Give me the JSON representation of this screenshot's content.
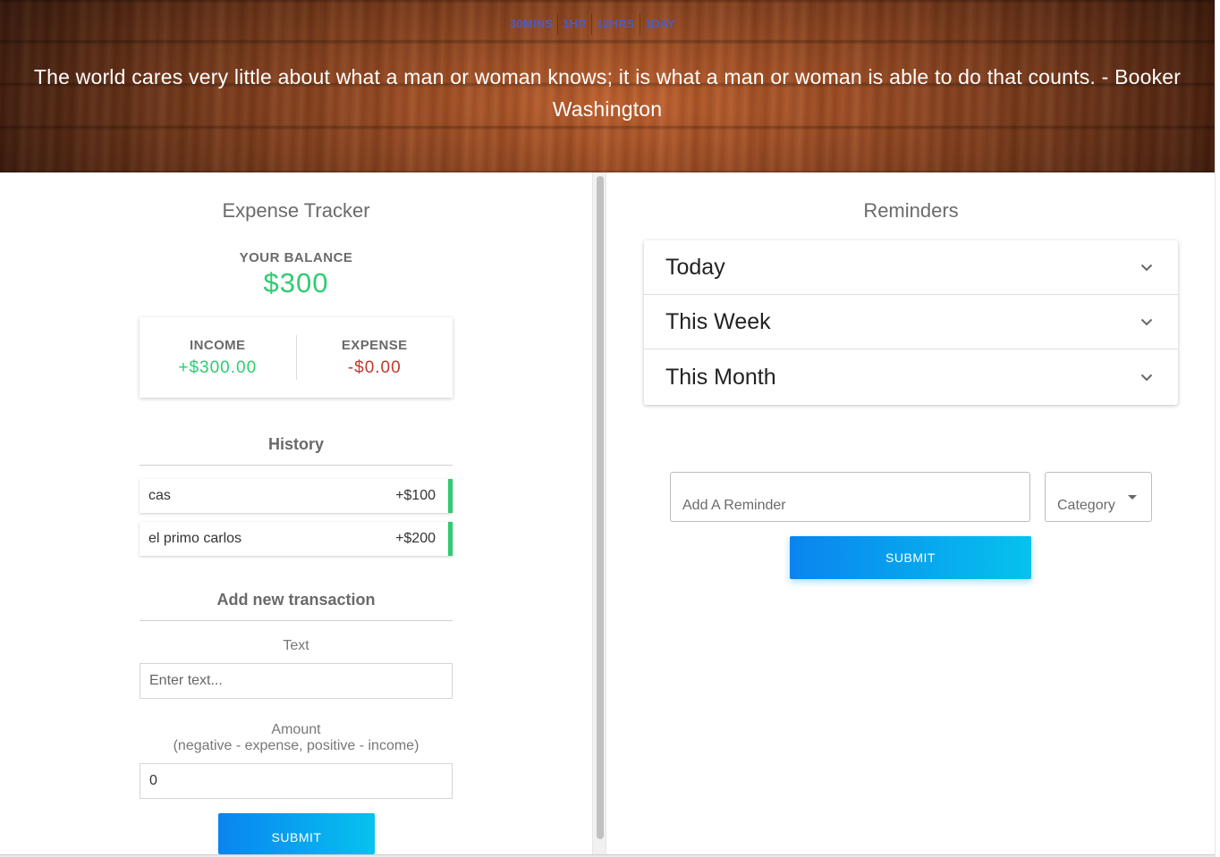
{
  "header": {
    "timer_tabs": [
      "30MINS",
      "1HR",
      "12HRS",
      "1DAY"
    ],
    "quote": "The world cares very little about what a man or woman knows; it is what a man or woman is able to do that counts. - Booker Washington"
  },
  "expense_tracker": {
    "title": "Expense Tracker",
    "balance_label": "YOUR BALANCE",
    "balance_value": "$300",
    "income_label": "INCOME",
    "income_value": "+$300.00",
    "expense_label": "EXPENSE",
    "expense_value": "-$0.00",
    "history_title": "History",
    "history": [
      {
        "text": "cas",
        "amount": "+$100"
      },
      {
        "text": "el primo carlos",
        "amount": "+$200"
      }
    ],
    "add_title": "Add new transaction",
    "text_label": "Text",
    "text_placeholder": "Enter text...",
    "amount_label_line1": "Amount",
    "amount_label_line2": "(negative - expense, positive - income)",
    "amount_value": "0",
    "submit_label": "SUBMIT"
  },
  "reminders": {
    "title": "Reminders",
    "sections": [
      "Today",
      "This Week",
      "This Month"
    ],
    "input_placeholder": "Add A Reminder",
    "category_label": "Category",
    "submit_label": "SUBMIT"
  },
  "colors": {
    "positive": "#2ecc71",
    "negative": "#c0392b",
    "button_start": "#0a84ef",
    "button_end": "#06c2ee",
    "timer_tab": "#4b5cc4"
  }
}
